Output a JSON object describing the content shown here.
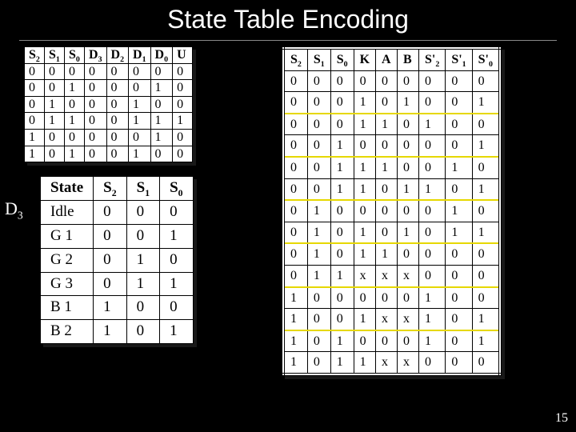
{
  "title": "State Table Encoding",
  "slide_number": "15",
  "d3_label": "D",
  "d3_sub": "3",
  "left_top": {
    "headers": [
      {
        "t": "S",
        "s": "2"
      },
      {
        "t": "S",
        "s": "1"
      },
      {
        "t": "S",
        "s": "0"
      },
      {
        "t": "D",
        "s": "3"
      },
      {
        "t": "D",
        "s": "2"
      },
      {
        "t": "D",
        "s": "1"
      },
      {
        "t": "D",
        "s": "0"
      },
      {
        "t": "U",
        "s": ""
      }
    ],
    "rows": [
      [
        "0",
        "0",
        "0",
        "0",
        "0",
        "0",
        "0",
        "0"
      ],
      [
        "0",
        "0",
        "1",
        "0",
        "0",
        "0",
        "1",
        "0"
      ],
      [
        "0",
        "1",
        "0",
        "0",
        "0",
        "1",
        "0",
        "0"
      ],
      [
        "0",
        "1",
        "1",
        "0",
        "0",
        "1",
        "1",
        "1"
      ],
      [
        "1",
        "0",
        "0",
        "0",
        "0",
        "0",
        "1",
        "0"
      ],
      [
        "1",
        "0",
        "1",
        "0",
        "0",
        "1",
        "0",
        "0"
      ]
    ]
  },
  "state": {
    "headers": [
      {
        "t": "State",
        "s": ""
      },
      {
        "t": "S",
        "s": "2"
      },
      {
        "t": "S",
        "s": "1"
      },
      {
        "t": "S",
        "s": "0"
      }
    ],
    "rows": [
      [
        "Idle",
        "0",
        "0",
        "0"
      ],
      [
        "G 1",
        "0",
        "0",
        "1"
      ],
      [
        "G 2",
        "0",
        "1",
        "0"
      ],
      [
        "G 3",
        "0",
        "1",
        "1"
      ],
      [
        "B 1",
        "1",
        "0",
        "0"
      ],
      [
        "B 2",
        "1",
        "0",
        "1"
      ]
    ]
  },
  "right": {
    "headers": [
      {
        "t": "S",
        "s": "2"
      },
      {
        "t": "S",
        "s": "1"
      },
      {
        "t": "S",
        "s": "0"
      },
      {
        "t": "K",
        "s": ""
      },
      {
        "t": "A",
        "s": ""
      },
      {
        "t": "B",
        "s": ""
      },
      {
        "t": "S'",
        "s": "2"
      },
      {
        "t": "S'",
        "s": "1"
      },
      {
        "t": "S'",
        "s": "0"
      }
    ],
    "rows": [
      [
        "0",
        "0",
        "0",
        "0",
        "0",
        "0",
        "0",
        "0",
        "0"
      ],
      [
        "0",
        "0",
        "0",
        "1",
        "0",
        "1",
        "0",
        "0",
        "1"
      ],
      [
        "0",
        "0",
        "0",
        "1",
        "1",
        "0",
        "1",
        "0",
        "0"
      ],
      [
        "0",
        "0",
        "1",
        "0",
        "0",
        "0",
        "0",
        "0",
        "1"
      ],
      [
        "0",
        "0",
        "1",
        "1",
        "1",
        "0",
        "0",
        "1",
        "0"
      ],
      [
        "0",
        "0",
        "1",
        "1",
        "0",
        "1",
        "1",
        "0",
        "1"
      ],
      [
        "0",
        "1",
        "0",
        "0",
        "0",
        "0",
        "0",
        "1",
        "0"
      ],
      [
        "0",
        "1",
        "0",
        "1",
        "0",
        "1",
        "0",
        "1",
        "1"
      ],
      [
        "0",
        "1",
        "0",
        "1",
        "1",
        "0",
        "0",
        "0",
        "0"
      ],
      [
        "0",
        "1",
        "1",
        "x",
        "x",
        "x",
        "0",
        "0",
        "0"
      ],
      [
        "1",
        "0",
        "0",
        "0",
        "0",
        "0",
        "1",
        "0",
        "0"
      ],
      [
        "1",
        "0",
        "0",
        "1",
        "x",
        "x",
        "1",
        "0",
        "1"
      ],
      [
        "1",
        "0",
        "1",
        "0",
        "0",
        "0",
        "1",
        "0",
        "1"
      ],
      [
        "1",
        "0",
        "1",
        "1",
        "x",
        "x",
        "0",
        "0",
        "0"
      ]
    ]
  }
}
